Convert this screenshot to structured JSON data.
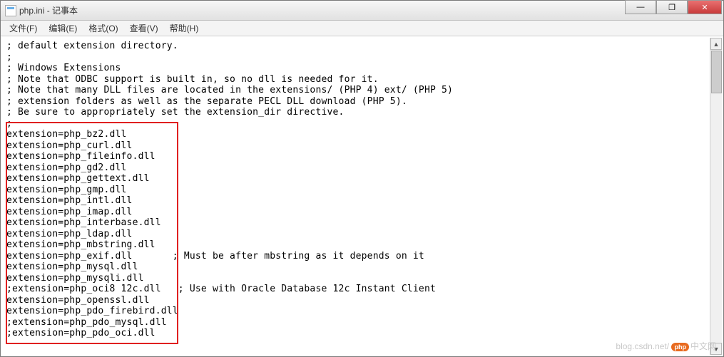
{
  "titlebar": {
    "title": "php.ini - 记事本"
  },
  "window_controls": {
    "minimize": "—",
    "maximize": "❐",
    "close": "✕"
  },
  "menu": {
    "file": "文件(F)",
    "edit": "编辑(E)",
    "format": "格式(O)",
    "view": "查看(V)",
    "help": "帮助(H)"
  },
  "content": {
    "line1": "; default extension directory.",
    "line2": ";",
    "line3": "; Windows Extensions",
    "line4": "; Note that ODBC support is built in, so no dll is needed for it.",
    "line5": "; Note that many DLL files are located in the extensions/ (PHP 4) ext/ (PHP 5)",
    "line6": "; extension folders as well as the separate PECL DLL download (PHP 5).",
    "line7": "; Be sure to appropriately set the extension_dir directive.",
    "line8": ";",
    "line9": "extension=php_bz2.dll",
    "line10": "extension=php_curl.dll",
    "line11": "extension=php_fileinfo.dll",
    "line12": "extension=php_gd2.dll",
    "line13": "extension=php_gettext.dll",
    "line14": "extension=php_gmp.dll",
    "line15": "extension=php_intl.dll",
    "line16": "extension=php_imap.dll",
    "line17": "extension=php_interbase.dll",
    "line18": "extension=php_ldap.dll",
    "line19": "extension=php_mbstring.dll",
    "line20": "extension=php_exif.dll       ; Must be after mbstring as it depends on it",
    "line21": "extension=php_mysql.dll",
    "line22": "extension=php_mysqli.dll",
    "line23": ";extension=php_oci8 12c.dll   ; Use with Oracle Database 12c Instant Client",
    "line24": "extension=php_openssl.dll",
    "line25": "extension=php_pdo_firebird.dll",
    "line26": ";extension=php_pdo_mysql.dll",
    "line27": ";extension=php_pdo_oci.dll"
  },
  "scrollbar": {
    "up": "▲",
    "down": "▼"
  },
  "watermark": {
    "url_prefix": "blog.csdn.net/",
    "badge": "php",
    "suffix": "中文网"
  }
}
